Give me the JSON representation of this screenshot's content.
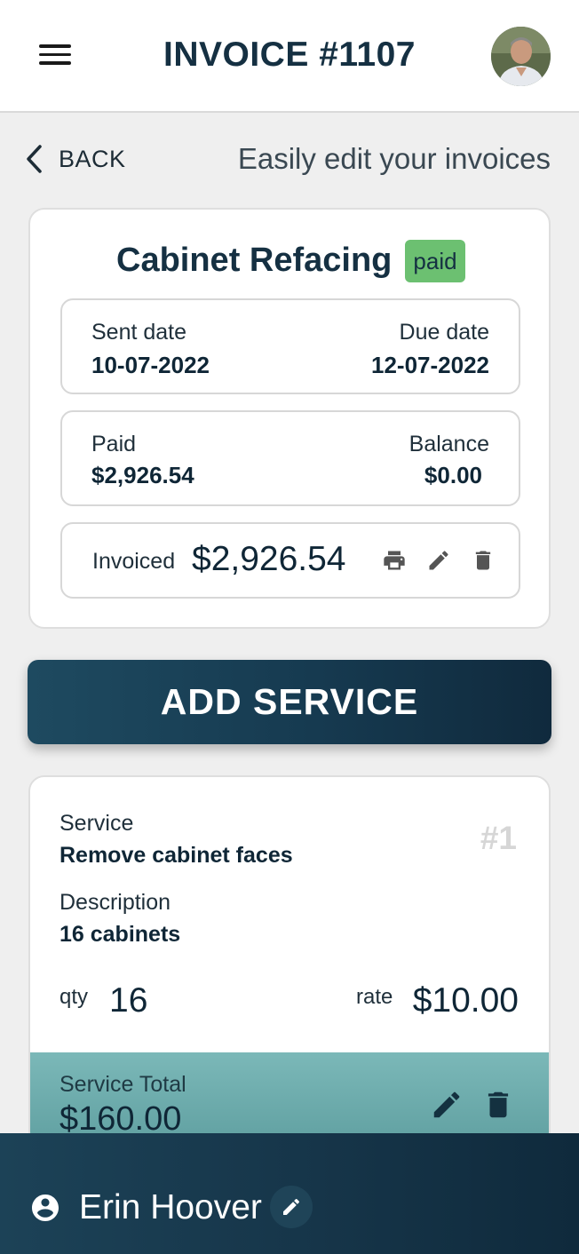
{
  "header": {
    "title": "INVOICE #1107",
    "menu_icon": "hamburger-menu-icon",
    "avatar_icon": "user-avatar"
  },
  "subheader": {
    "back_label": "BACK",
    "tagline": "Easily edit your invoices"
  },
  "invoice": {
    "title": "Cabinet Refacing",
    "status": "paid",
    "sent_date_label": "Sent date",
    "sent_date": "10-07-2022",
    "due_date_label": "Due date",
    "due_date": "12-07-2022",
    "paid_label": "Paid",
    "paid_amount": "$2,926.54",
    "balance_label": "Balance",
    "balance_amount": "$0.00",
    "invoiced_label": "Invoiced",
    "invoiced_amount": "$2,926.54",
    "actions": [
      "print-icon",
      "edit-icon",
      "delete-icon"
    ]
  },
  "add_service_label": "ADD SERVICE",
  "service": {
    "number": "#1",
    "service_label": "Service",
    "service_name": "Remove cabinet faces",
    "description_label": "Description",
    "description": "16 cabinets",
    "qty_label": "qty",
    "qty": "16",
    "rate_label": "rate",
    "rate": "$10.00",
    "total_label": "Service Total",
    "total": "$160.00"
  },
  "footer": {
    "user_name": "Erin Hoover"
  },
  "colors": {
    "primary_dark": "#153042",
    "paid_badge": "#6cc071",
    "service_total_bg": "#6fa9aa"
  }
}
